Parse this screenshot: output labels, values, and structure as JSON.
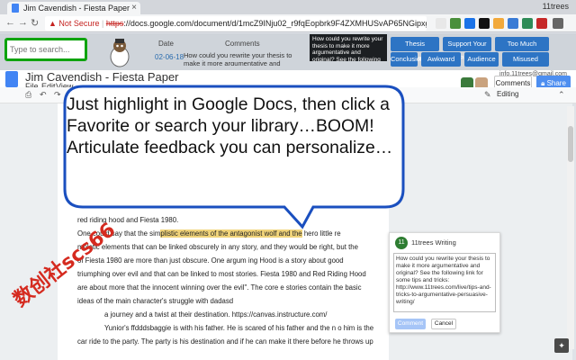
{
  "browser": {
    "tab_title": "Jim Cavendish - Fiesta Paper",
    "tab_close": "×",
    "profile": "11trees",
    "not_secure": "Not Secure",
    "url_scheme": "https",
    "url_rest": "://docs.google.com/document/d/1mcZ9INju02_r9fqEopbrk9F4ZXMHUSvAP65NGipxggM/edit",
    "secure_icon": "warning-icon"
  },
  "extension": {
    "search_placeholder": "Type to search...",
    "col_date": "Date",
    "col_comments": "Comments",
    "feedback_date": "02-06-18",
    "feedback_text": "How could you rewrite your thesis to make it more argumentative and original? See the following link for...",
    "popup_text": "How could you rewrite your thesis to make it more argumentative and original? See the following link for some tips and tricks: http://www.11trees...",
    "buttons": [
      "Thesis Originality",
      "Support Your Point",
      "Too Much Summary",
      "Conclusion",
      "Awkward",
      "Audience",
      "Misused Comma"
    ]
  },
  "docs": {
    "doc_title": "Jim Cavendish - Fiesta Paper",
    "menu": [
      "File",
      "Edit",
      "View"
    ],
    "email": "info.11trees@gmail.com",
    "comments_label": "Comments",
    "share_label": "Share",
    "editing_label": "Editing"
  },
  "document": {
    "lines": [
      {
        "pre": "red riding hood and Fiesta 1980.",
        "hl": "",
        "post": ""
      },
      {
        "pre": "One could say that the sim",
        "hl": "plistic elements of the antagonist wolf and the",
        "post": " hero little re"
      },
      {
        "pre": "mpletic elements that can be linked obscurely in any story, and they would be right, but the",
        "hl": "",
        "post": ""
      },
      {
        "pre": "of Fiesta 1980 are more than just obscure. One argum ing Hood is a story about good",
        "hl": "",
        "post": ""
      },
      {
        "pre": "triumphing over evil and that can be linked to most stories. Fiesta 1980 and Red Riding Hood",
        "hl": "",
        "post": ""
      },
      {
        "pre": "are about more that the innocent winning over the evil\". The core e  stories contain the basic",
        "hl": "",
        "post": ""
      },
      {
        "pre": "ideas of the main character's struggle with dadasd",
        "hl": "",
        "post": ""
      },
      {
        "pre": "a journey and a twist at their destination. https://canvas.instructure.com/",
        "hl": "",
        "post": ""
      },
      {
        "pre": "Yunior's ffdddsbaggie is with his father. He is scared of his father and the n o him is the",
        "hl": "",
        "post": ""
      },
      {
        "pre": "car ride to the party. The party is his destination and if he can make it there before he throws up",
        "hl": "",
        "post": ""
      }
    ]
  },
  "comment_panel": {
    "avatar_text": "11",
    "author": "11trees Writing",
    "text": "How could you rewrite your thesis to make it more argumentative and original? See the following link for some tips and tricks: http://www.11trees.com/live/tips-and-tricks-to-argumentative-persuasive-writing/",
    "comment_label": "Comment",
    "cancel_label": "Cancel"
  },
  "bubble": {
    "text": "Just highlight in Google Docs, then click a Favorite or search your library…BOOM! Articulate feedback you can personalize…"
  },
  "watermark": {
    "text": "数创社scs66"
  },
  "colors": {
    "bubble_border": "#1a4fbf",
    "highlight": "#f1d47a",
    "search_border": "#0ea30e",
    "button_blue": "#2d74c4"
  }
}
